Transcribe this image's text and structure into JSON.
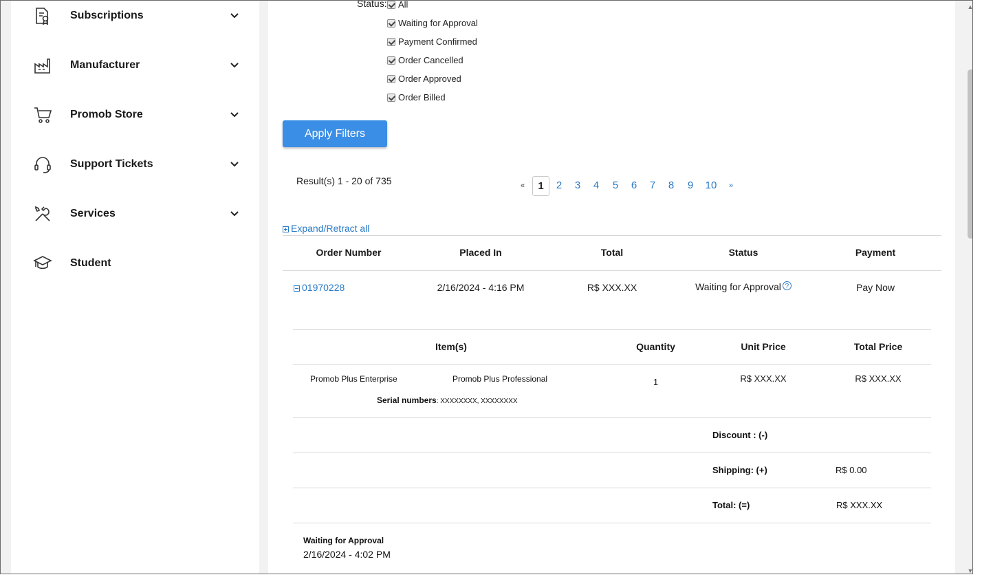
{
  "sidebar": {
    "items": [
      {
        "label": "Subscriptions",
        "icon": "certificate-document-icon",
        "expandable": true
      },
      {
        "label": "Manufacturer",
        "icon": "factory-icon",
        "expandable": true
      },
      {
        "label": "Promob Store",
        "icon": "shopping-cart-icon",
        "expandable": true
      },
      {
        "label": "Support Tickets",
        "icon": "headset-icon",
        "expandable": true
      },
      {
        "label": "Services",
        "icon": "tools-icon",
        "expandable": true
      },
      {
        "label": "Student",
        "icon": "graduation-cap-icon",
        "expandable": false
      }
    ]
  },
  "filters": {
    "status_label": "Status:",
    "options": [
      {
        "label": "All",
        "checked": true
      },
      {
        "label": "Waiting for Approval",
        "checked": true
      },
      {
        "label": "Payment Confirmed",
        "checked": true
      },
      {
        "label": "Order Cancelled",
        "checked": true
      },
      {
        "label": "Order Approved",
        "checked": true
      },
      {
        "label": "Order Billed",
        "checked": true
      }
    ],
    "apply_label": "Apply Filters"
  },
  "results": {
    "summary": "Result(s) 1 - 20 of 735",
    "pagination": {
      "prev": "«",
      "pages": [
        "1",
        "2",
        "3",
        "4",
        "5",
        "6",
        "7",
        "8",
        "9",
        "10"
      ],
      "current": "1",
      "next": "»"
    }
  },
  "orders": {
    "expand_label": "Expand/Retract all",
    "headers": [
      "Order Number",
      "Placed In",
      "Total",
      "Status",
      "Payment"
    ],
    "row": {
      "number": "01970228",
      "placed_in": "2/16/2024 - 4:16 PM",
      "total": "R$ XXX.XX",
      "status": "Waiting for Approval",
      "status_help": "?",
      "payment": "Pay Now"
    },
    "detail": {
      "headers": [
        "Item(s)",
        "Quantity",
        "Unit Price",
        "Total Price"
      ],
      "item_name": "Promob Plus Enterprise",
      "item_variant": "Promob Plus Professional",
      "quantity": "1",
      "unit_price": "R$ XXX.XX",
      "total_price": "R$ XXX.XX",
      "serial_label": "Serial numbers",
      "serial_value": ": XXXXXXXX, XXXXXXXX",
      "discount_label": "Discount : (-)",
      "shipping_label": "Shipping: (+)",
      "shipping_value": "R$ 0.00",
      "total_label": "Total: (=)",
      "total_value": "R$ XXX.XX"
    },
    "history": {
      "status": "Waiting for Approval",
      "date": "2/16/2024 - 4:02 PM"
    }
  }
}
